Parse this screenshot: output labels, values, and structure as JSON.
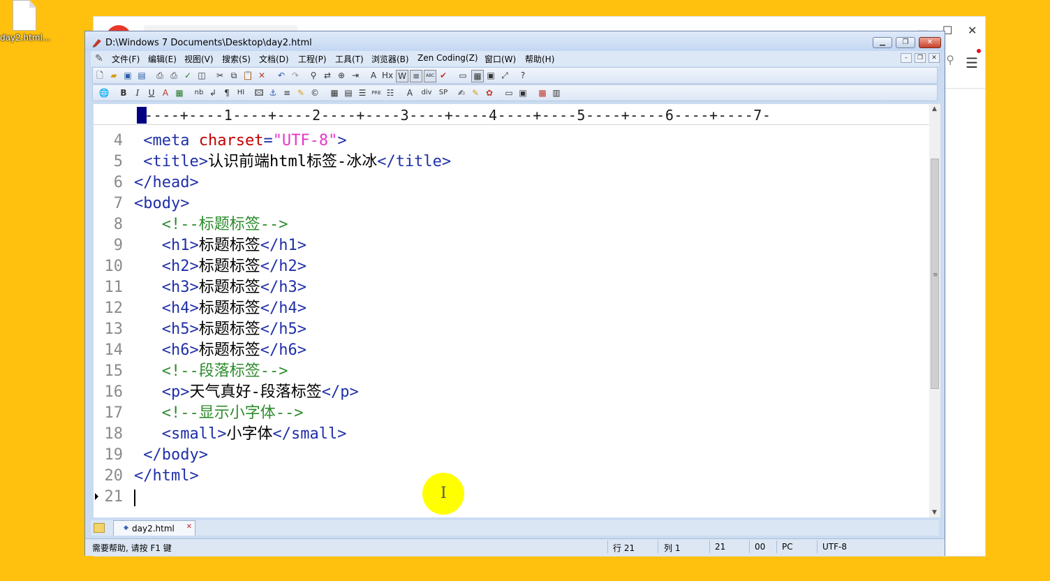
{
  "desktop": {
    "icon_label": "day2.html..."
  },
  "window": {
    "title": "D:\\Windows 7 Documents\\Desktop\\day2.html"
  },
  "menu": [
    {
      "label": "文件(F)"
    },
    {
      "label": "编辑(E)"
    },
    {
      "label": "视图(V)"
    },
    {
      "label": "搜索(S)"
    },
    {
      "label": "文档(D)"
    },
    {
      "label": "工程(P)"
    },
    {
      "label": "工具(T)"
    },
    {
      "label": "浏览器(B)"
    },
    {
      "label": "Zen Coding(Z)"
    },
    {
      "label": "窗口(W)"
    },
    {
      "label": "帮助(H)"
    }
  ],
  "toolbar2_labels": {
    "nb": "nb",
    "hr": "HI",
    "pre": "PRE",
    "div": "div",
    "sp": "SP",
    "hx": "Hx",
    "w": "W",
    "abc": "ABC"
  },
  "ruler": {
    "text": "----+----1----+----2----+----3----+----4----+----5----+----6----+----7-"
  },
  "code_lines": [
    {
      "n": "4",
      "parts": [
        [
          "tag",
          " <meta "
        ],
        [
          "attr",
          "charset"
        ],
        [
          "tag",
          "="
        ],
        [
          "val",
          "\"UTF-8\""
        ],
        [
          "tag",
          ">"
        ]
      ]
    },
    {
      "n": "5",
      "parts": [
        [
          "tag",
          " <title>"
        ],
        [
          "txt",
          "认识前端html标签-冰冰"
        ],
        [
          "tag",
          "</title>"
        ]
      ]
    },
    {
      "n": "6",
      "parts": [
        [
          "tag",
          "</head>"
        ]
      ]
    },
    {
      "n": "7",
      "parts": [
        [
          "tag",
          "<body>"
        ]
      ]
    },
    {
      "n": "8",
      "parts": [
        [
          "cm",
          "   <!--标题标签-->"
        ]
      ]
    },
    {
      "n": "9",
      "parts": [
        [
          "tag",
          "   <h1>"
        ],
        [
          "txt",
          "标题标签"
        ],
        [
          "tag",
          "</h1>"
        ]
      ]
    },
    {
      "n": "10",
      "parts": [
        [
          "tag",
          "   <h2>"
        ],
        [
          "txt",
          "标题标签"
        ],
        [
          "tag",
          "</h2>"
        ]
      ]
    },
    {
      "n": "11",
      "parts": [
        [
          "tag",
          "   <h3>"
        ],
        [
          "txt",
          "标题标签"
        ],
        [
          "tag",
          "</h3>"
        ]
      ]
    },
    {
      "n": "12",
      "parts": [
        [
          "tag",
          "   <h4>"
        ],
        [
          "txt",
          "标题标签"
        ],
        [
          "tag",
          "</h4>"
        ]
      ]
    },
    {
      "n": "13",
      "parts": [
        [
          "tag",
          "   <h5>"
        ],
        [
          "txt",
          "标题标签"
        ],
        [
          "tag",
          "</h5>"
        ]
      ]
    },
    {
      "n": "14",
      "parts": [
        [
          "tag",
          "   <h6>"
        ],
        [
          "txt",
          "标题标签"
        ],
        [
          "tag",
          "</h6>"
        ]
      ]
    },
    {
      "n": "15",
      "parts": [
        [
          "cm",
          "   <!--段落标签-->"
        ]
      ]
    },
    {
      "n": "16",
      "parts": [
        [
          "tag",
          "   <p>"
        ],
        [
          "txt",
          "天气真好-段落标签"
        ],
        [
          "tag",
          "</p>"
        ]
      ]
    },
    {
      "n": "17",
      "parts": [
        [
          "cm",
          "   <!--显示小字体-->"
        ]
      ]
    },
    {
      "n": "18",
      "parts": [
        [
          "tag",
          "   <small>"
        ],
        [
          "txt",
          "小字体"
        ],
        [
          "tag",
          "</small>"
        ]
      ]
    },
    {
      "n": "19",
      "parts": [
        [
          "tag",
          " </body>"
        ]
      ]
    },
    {
      "n": "20",
      "parts": [
        [
          "tag",
          "</html>"
        ]
      ]
    },
    {
      "n": "21",
      "parts": []
    }
  ],
  "file_tab": {
    "label": "day2.html"
  },
  "status": {
    "help": "需要帮助, 请按 F1 键",
    "row": "行 21",
    "col": "列 1",
    "num": "21",
    "code": "00",
    "mode": "PC",
    "encoding": "UTF-8"
  },
  "colors": {
    "tag": "#1f2fa8",
    "attr": "#c20000",
    "value": "#e636c9",
    "comment": "#2c8c2c",
    "highlight": "#ffff00",
    "desktop": "#FFC10E"
  }
}
